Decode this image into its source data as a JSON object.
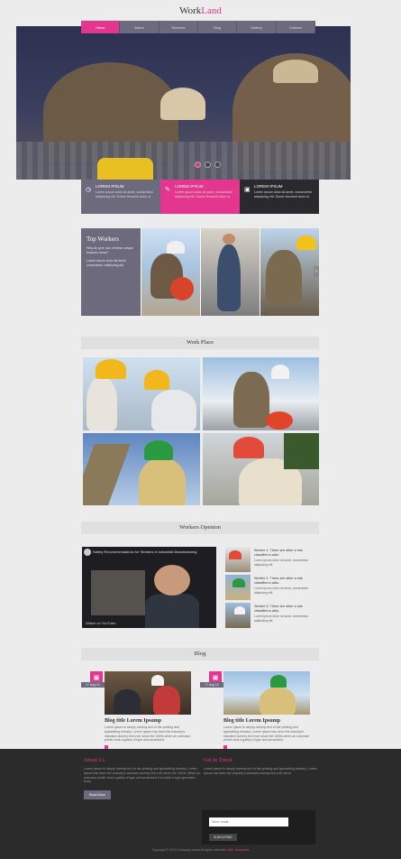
{
  "header": {
    "logo_main": "Work",
    "logo_accent": "Land"
  },
  "nav": {
    "items": [
      "Home",
      "About",
      "Services",
      "Blog",
      "Gallery",
      "Contact"
    ],
    "active_index": 0
  },
  "hero": {
    "slide_count": 3,
    "active_slide": 1
  },
  "features": [
    {
      "icon": "clock-icon",
      "glyph": "◷",
      "title": "LOREM IPSUM",
      "text": "Lorem ipsum dolor sit amet, consectetur adipiscing elit. Donec feument dolor ut."
    },
    {
      "icon": "wrench-icon",
      "glyph": "✎",
      "title": "LOREM IPSUM",
      "text": "Lorem ipsum dolor sit amet, consectetur adipiscing elit. Donec feument dolor ut."
    },
    {
      "icon": "briefcase-icon",
      "glyph": "▣",
      "title": "LOREM IPSUM",
      "text": "Lorem ipsum dolor sit amet, consectetur adipiscing elit. Donec feument dolor ut."
    }
  ],
  "top_workers": {
    "title": "Top Workers",
    "text1": "Why do give use of these unique features since?",
    "text2": "Lorem ipsum dolor sit amet, consectetur adipiscing elit."
  },
  "work_place": {
    "title": "Work Place"
  },
  "workers_opinion": {
    "title": "Workers Openion",
    "video_title": "Safety Recommendations for Workers in Industrial Manufacturing",
    "video_brand": "Watch on YouTube",
    "items": [
      {
        "title": "Worker 1: There are other a lots classified a adio.",
        "text": "Lorem ipsum dolor sit amet, consectetur adipiscing elit."
      },
      {
        "title": "Worker 2: There are other a lots classified a adio.",
        "text": "Lorem ipsum dolor sit amet, consectetur adipiscing elit."
      },
      {
        "title": "Worker 3: There are other a lots classified a adio.",
        "text": "Lorem ipsum dolor sit amet, consectetur adipiscing elit."
      }
    ]
  },
  "blog": {
    "title": "Blog",
    "posts": [
      {
        "date": "17 Aug 15",
        "title": "Blog title Lorem Ipsump",
        "text": "Lorem Ipsum is simply dummy text of the printing and typesetting industry. Lorem Ipsum has been the industry's standard dummy text ever since the 1500s when an unknown printer took a galley of type and scrambled."
      },
      {
        "date": "17 Aug 15",
        "title": "Blog title Lorem Ipsump",
        "text": "Lorem Ipsum is simply dummy text of the printing and typesetting industry. Lorem Ipsum has been the industry's standard dummy text ever since the 1500s when an unknown printer took a galley of type and scrambled."
      }
    ]
  },
  "footer": {
    "about_title": "About Us",
    "about_text": "Lorem Ipsum is simply dummy text of the printing and typesetting industry. Lorem Ipsum has been the industry's standard dummy text ever since the 1500s. When an unknown printer took a galley of type and scrambled it to make a type specimen book.",
    "read_more": "Read More",
    "touch_title": "Get In Touch",
    "touch_text": "Lorem Ipsum is simply dummy text of the printing and typesetting industry. Lorem Ipsum has been the industry's standard dummy text ever since.",
    "email_placeholder": "Enter email...",
    "subscribe": "SUBSCRIBE",
    "copyright": "Copyright © 2015 Company name All rights reserved.",
    "copyright_link": "Web Templates"
  },
  "colors": {
    "accent": "#e4368f",
    "slate": "#6e6a7e",
    "dark": "#2a2a2e"
  }
}
